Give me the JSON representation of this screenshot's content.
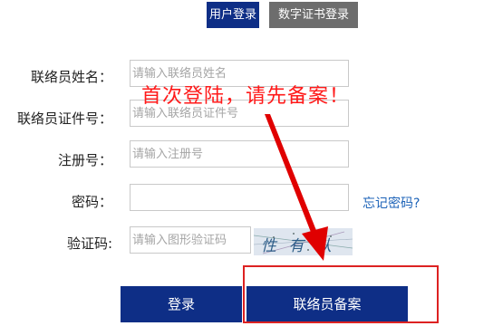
{
  "tabs": {
    "user_login": "用户登录",
    "cert_login": "数字证书登录"
  },
  "form": {
    "contact_name_label": "联络员姓名：",
    "contact_name_placeholder": "请输入联络员姓名",
    "contact_id_label": "联络员证件号：",
    "contact_id_placeholder": "请输入联络员证件号",
    "reg_no_label": "注册号：",
    "reg_no_placeholder": "请输入注册号",
    "password_label": "密码：",
    "password_placeholder": "",
    "captcha_label": "验证码:",
    "captcha_placeholder": "请输入图形验证码",
    "captcha_text": "性 有 认",
    "forgot_password": "忘记密码?"
  },
  "annotation": {
    "notice": "首次登陆，请先备案！",
    "color": "#ff1a1a"
  },
  "buttons": {
    "login": "登录",
    "register": "联络员备案"
  },
  "colors": {
    "primary": "#0e2e86",
    "tab_inactive": "#6d6d6d",
    "link": "#1d63b8"
  }
}
